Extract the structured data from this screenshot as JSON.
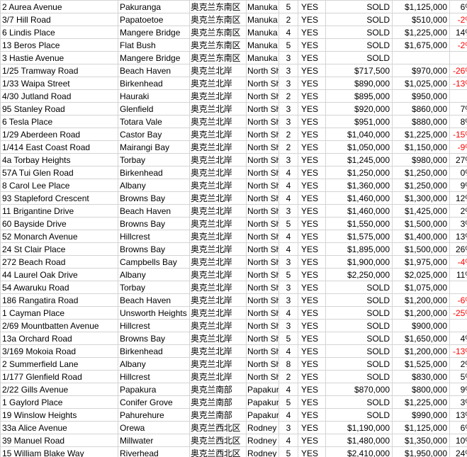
{
  "colors": {
    "negative": "#ff0000",
    "grid": "#d4d4d4"
  },
  "rows": [
    [
      "2 Aurea Avenue",
      "Pakuranga",
      "奥克兰东南区",
      "Manuka",
      "5",
      "YES",
      "SOLD",
      "$1,125,000",
      "6%"
    ],
    [
      "3/7 Hill Road",
      "Papatoetoe",
      "奥克兰东南区",
      "Manuka",
      "2",
      "YES",
      "SOLD",
      "$510,000",
      "-2%"
    ],
    [
      "6 Lindis Place",
      "Mangere Bridge",
      "奥克兰东南区",
      "Manuka",
      "4",
      "YES",
      "SOLD",
      "$1,225,000",
      "14%"
    ],
    [
      "13 Beros Place",
      "Flat Bush",
      "奥克兰东南区",
      "Manuka",
      "5",
      "YES",
      "SOLD",
      "$1,675,000",
      "-2%"
    ],
    [
      "3 Hastie Avenue",
      "Mangere Bridge",
      "奥克兰东南区",
      "Manuka",
      "3",
      "YES",
      "SOLD",
      "",
      ""
    ],
    [
      "1/25 Tramway Road",
      "Beach Haven",
      "奥克兰北岸",
      "North Sho",
      "3",
      "YES",
      "$717,500",
      "$970,000",
      "-26%"
    ],
    [
      "1/33 Waipa Street",
      "Birkenhead",
      "奥克兰北岸",
      "North Sho",
      "3",
      "YES",
      "$890,000",
      "$1,025,000",
      "-13%"
    ],
    [
      "4/30 Jutland Road",
      "Hauraki",
      "奥克兰北岸",
      "North Sho",
      "2",
      "YES",
      "$895,000",
      "$950,000",
      ""
    ],
    [
      "95 Stanley Road",
      "Glenfield",
      "奥克兰北岸",
      "North Sho",
      "3",
      "YES",
      "$920,000",
      "$860,000",
      "7%"
    ],
    [
      "6 Tesla Place",
      "Totara Vale",
      "奥克兰北岸",
      "North Sho",
      "3",
      "YES",
      "$951,000",
      "$880,000",
      "8%"
    ],
    [
      "1/29 Aberdeen Road",
      "Castor Bay",
      "奥克兰北岸",
      "North Sho",
      "2",
      "YES",
      "$1,040,000",
      "$1,225,000",
      "-15%"
    ],
    [
      "1/414 East Coast Road",
      "Mairangi Bay",
      "奥克兰北岸",
      "North Sho",
      "2",
      "YES",
      "$1,050,000",
      "$1,150,000",
      "-9%"
    ],
    [
      "4a Torbay Heights",
      "Torbay",
      "奥克兰北岸",
      "North Sho",
      "3",
      "YES",
      "$1,245,000",
      "$980,000",
      "27%"
    ],
    [
      "57A Tui Glen Road",
      "Birkenhead",
      "奥克兰北岸",
      "North Sho",
      "4",
      "YES",
      "$1,250,000",
      "$1,250,000",
      "0%"
    ],
    [
      "8 Carol Lee Place",
      "Albany",
      "奥克兰北岸",
      "North Sho",
      "4",
      "YES",
      "$1,360,000",
      "$1,250,000",
      "9%"
    ],
    [
      "93 Stapleford Crescent",
      "Browns Bay",
      "奥克兰北岸",
      "North Sho",
      "4",
      "YES",
      "$1,460,000",
      "$1,300,000",
      "12%"
    ],
    [
      "11 Brigantine Drive",
      "Beach Haven",
      "奥克兰北岸",
      "North Sho",
      "3",
      "YES",
      "$1,460,000",
      "$1,425,000",
      "2%"
    ],
    [
      "60 Bayside Drive",
      "Browns Bay",
      "奥克兰北岸",
      "North Sho",
      "5",
      "YES",
      "$1,550,000",
      "$1,500,000",
      "3%"
    ],
    [
      "52 Monarch Avenue",
      "Hillcrest",
      "奥克兰北岸",
      "North Sho",
      "4",
      "YES",
      "$1,575,000",
      "$1,400,000",
      "13%"
    ],
    [
      "24 St Clair Place",
      "Browns Bay",
      "奥克兰北岸",
      "North Sho",
      "4",
      "YES",
      "$1,895,000",
      "$1,500,000",
      "26%"
    ],
    [
      "272 Beach Road",
      "Campbells Bay",
      "奥克兰北岸",
      "North Sho",
      "3",
      "YES",
      "$1,900,000",
      "$1,975,000",
      "-4%"
    ],
    [
      "44 Laurel Oak Drive",
      "Albany",
      "奥克兰北岸",
      "North Sho",
      "5",
      "YES",
      "$2,250,000",
      "$2,025,000",
      "11%"
    ],
    [
      "54 Awaruku Road",
      "Torbay",
      "奥克兰北岸",
      "North Sho",
      "3",
      "YES",
      "SOLD",
      "$1,075,000",
      ""
    ],
    [
      "186 Rangatira Road",
      "Beach Haven",
      "奥克兰北岸",
      "North Sho",
      "3",
      "YES",
      "SOLD",
      "$1,200,000",
      "-6%"
    ],
    [
      "1 Cayman Place",
      "Unsworth Heights",
      "奥克兰北岸",
      "North Sho",
      "4",
      "YES",
      "SOLD",
      "$1,200,000",
      "-25%"
    ],
    [
      "2/69 Mountbatten Avenue",
      "Hillcrest",
      "奥克兰北岸",
      "North Sho",
      "3",
      "YES",
      "SOLD",
      "$900,000",
      ""
    ],
    [
      "13a Orchard Road",
      "Browns Bay",
      "奥克兰北岸",
      "North Sho",
      "5",
      "YES",
      "SOLD",
      "$1,650,000",
      "4%"
    ],
    [
      "3/169 Mokoia Road",
      "Birkenhead",
      "奥克兰北岸",
      "North Sho",
      "4",
      "YES",
      "SOLD",
      "$1,200,000",
      "-13%"
    ],
    [
      "2 Summerfield Lane",
      "Albany",
      "奥克兰北岸",
      "North Sho",
      "8",
      "YES",
      "SOLD",
      "$1,525,000",
      "2%"
    ],
    [
      "1/177 Glenfield Road",
      "Hillcrest",
      "奥克兰北岸",
      "North Sho",
      "2",
      "YES",
      "SOLD",
      "$830,000",
      "5%"
    ],
    [
      "2/22 Gills Avenue",
      "Papakura",
      "奥克兰南部",
      "Papakura",
      "4",
      "YES",
      "$870,000",
      "$800,000",
      "9%"
    ],
    [
      "1 Gaylord Place",
      "Conifer Grove",
      "奥克兰南部",
      "Papakura",
      "5",
      "YES",
      "SOLD",
      "$1,225,000",
      "3%"
    ],
    [
      "19 Winslow Heights",
      "Pahurehure",
      "奥克兰南部",
      "Papakura",
      "4",
      "YES",
      "SOLD",
      "$990,000",
      "13%"
    ],
    [
      "33a Alice Avenue",
      "Orewa",
      "奥克兰西北区",
      "Rodney",
      "3",
      "YES",
      "$1,190,000",
      "$1,125,000",
      "6%"
    ],
    [
      "39 Manuel Road",
      "Millwater",
      "奥克兰西北区",
      "Rodney",
      "4",
      "YES",
      "$1,480,000",
      "$1,350,000",
      "10%"
    ],
    [
      "15 William Blake Way",
      "Riverhead",
      "奥克兰西北区",
      "Rodney",
      "5",
      "YES",
      "$2,410,000",
      "$1,950,000",
      "24%"
    ]
  ]
}
